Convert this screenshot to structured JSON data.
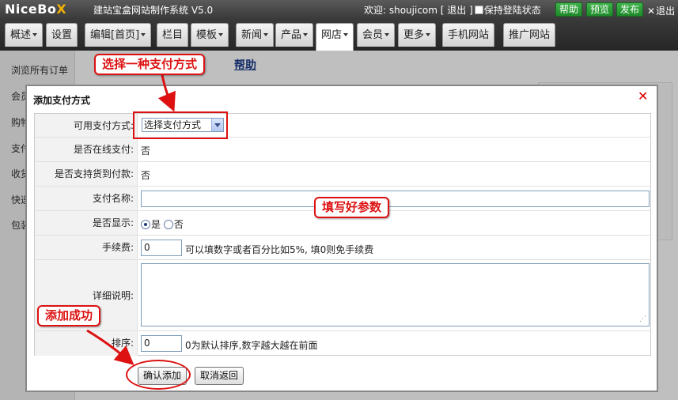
{
  "header": {
    "logo_main": "NiceBo",
    "logo_accent": "X",
    "system_title": "建站宝盒网站制作系统 V5.0",
    "welcome": "欢迎: shoujicom [ 退出 ]",
    "keep_login": "保持登陆状态",
    "buttons": {
      "help": "帮助",
      "preview": "预览",
      "publish": "发布"
    },
    "exit": "退出"
  },
  "nav": {
    "items": [
      "概述",
      "设置",
      "编辑[首页]",
      "栏目",
      "模板",
      "新闻",
      "产品",
      "网店",
      "会员",
      "更多",
      "手机网站",
      "推广网站"
    ],
    "active": "网店"
  },
  "background": {
    "sidebar_items": [
      "浏览所有订单",
      "会员",
      "购物",
      "支付",
      "收货",
      "快递",
      "包装"
    ],
    "help_link": "帮助"
  },
  "dialog": {
    "title": "添加支付方式",
    "fields": {
      "payment_method_label": "可用支付方式:",
      "payment_method_selected": "选择支付方式",
      "online_pay_label": "是否在线支付:",
      "online_pay_value": "否",
      "cod_label": "是否支持货到付款:",
      "cod_value": "否",
      "name_label": "支付名称:",
      "name_value": "",
      "display_label": "是否显示:",
      "display_yes": "是",
      "display_no": "否",
      "fee_label": "手续费:",
      "fee_value": "0",
      "fee_hint": "可以填数字或者百分比如5%, 填0则免手续费",
      "desc_label": "详细说明:",
      "sort_label": "排序:",
      "sort_value": "0",
      "sort_hint": "0为默认排序,数字越大越在前面"
    },
    "buttons": {
      "confirm": "确认添加",
      "cancel": "取消返回"
    }
  },
  "annotations": {
    "select_method": "选择一种支付方式",
    "fill_params": "填写好参数",
    "add_success": "添加成功",
    "color": "#dd1111"
  }
}
